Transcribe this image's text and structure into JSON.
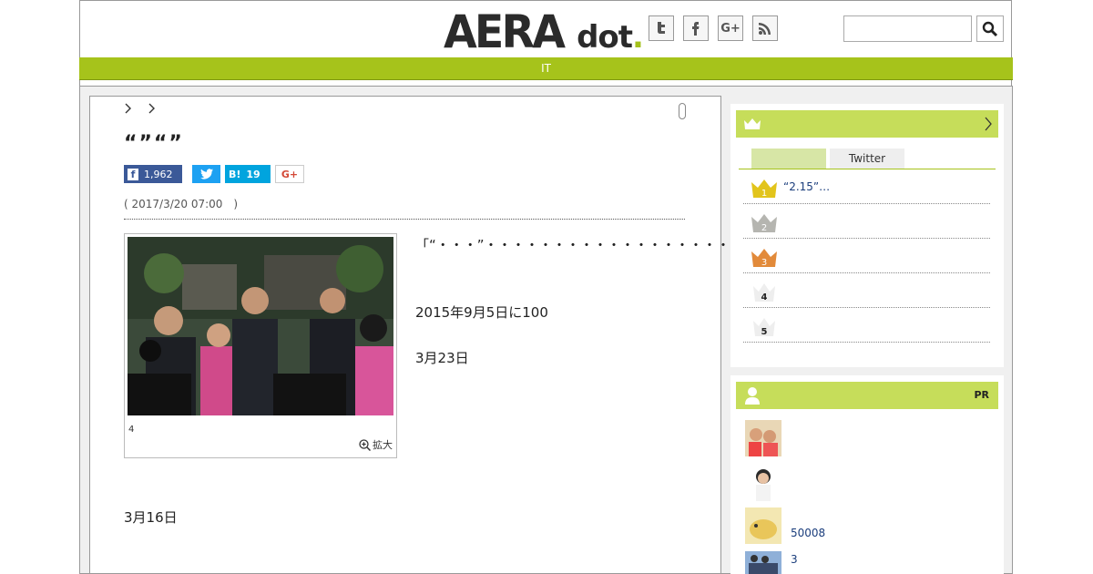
{
  "header": {
    "logo_main": "AERA",
    "logo_sub_a": "dot",
    "logo_sub_b": ".",
    "social_icons": [
      "twitter-icon",
      "facebook-icon",
      "google-plus-icon",
      "rss-icon"
    ],
    "social_glyphs": [
      "t",
      "f",
      "G+",
      ""
    ],
    "search_placeholder": ""
  },
  "nav": {
    "label": "IT"
  },
  "article": {
    "breadcrumb": [
      ">",
      ">"
    ],
    "title": "“”“”",
    "share": {
      "facebook_count": "1,962",
      "hatena_label": "B!",
      "hatena_count": "19",
      "google_label": "G+"
    },
    "date": "( 2017/3/20 07:00　)",
    "photo_caption": "4",
    "zoom_label": "拡大",
    "paragraphs": [
      "「“・・・”・・・・・・・・・・・・・・・・・・・・・・・・・・・・・・・・・",
      "2015年9月5日に100",
      "3月23日",
      "3月16日"
    ]
  },
  "sidebar": {
    "ranking_tabs": [
      "",
      "Twitter"
    ],
    "ranking_items": [
      {
        "rank": "1",
        "text": "“2.15”…"
      },
      {
        "rank": "2",
        "text": ""
      },
      {
        "rank": "3",
        "text": ""
      },
      {
        "rank": "4",
        "text": ""
      },
      {
        "rank": "5",
        "text": ""
      }
    ],
    "pr_label": "PR",
    "pr_items": [
      {
        "text": ""
      },
      {
        "text": ""
      },
      {
        "text": "50008"
      },
      {
        "text": "3"
      }
    ]
  },
  "colors": {
    "brand_green": "#a6c31b",
    "header_bar": "#c6dd5a",
    "facebook": "#3b5998",
    "twitter": "#1da1f2",
    "hatena": "#00a4de"
  }
}
